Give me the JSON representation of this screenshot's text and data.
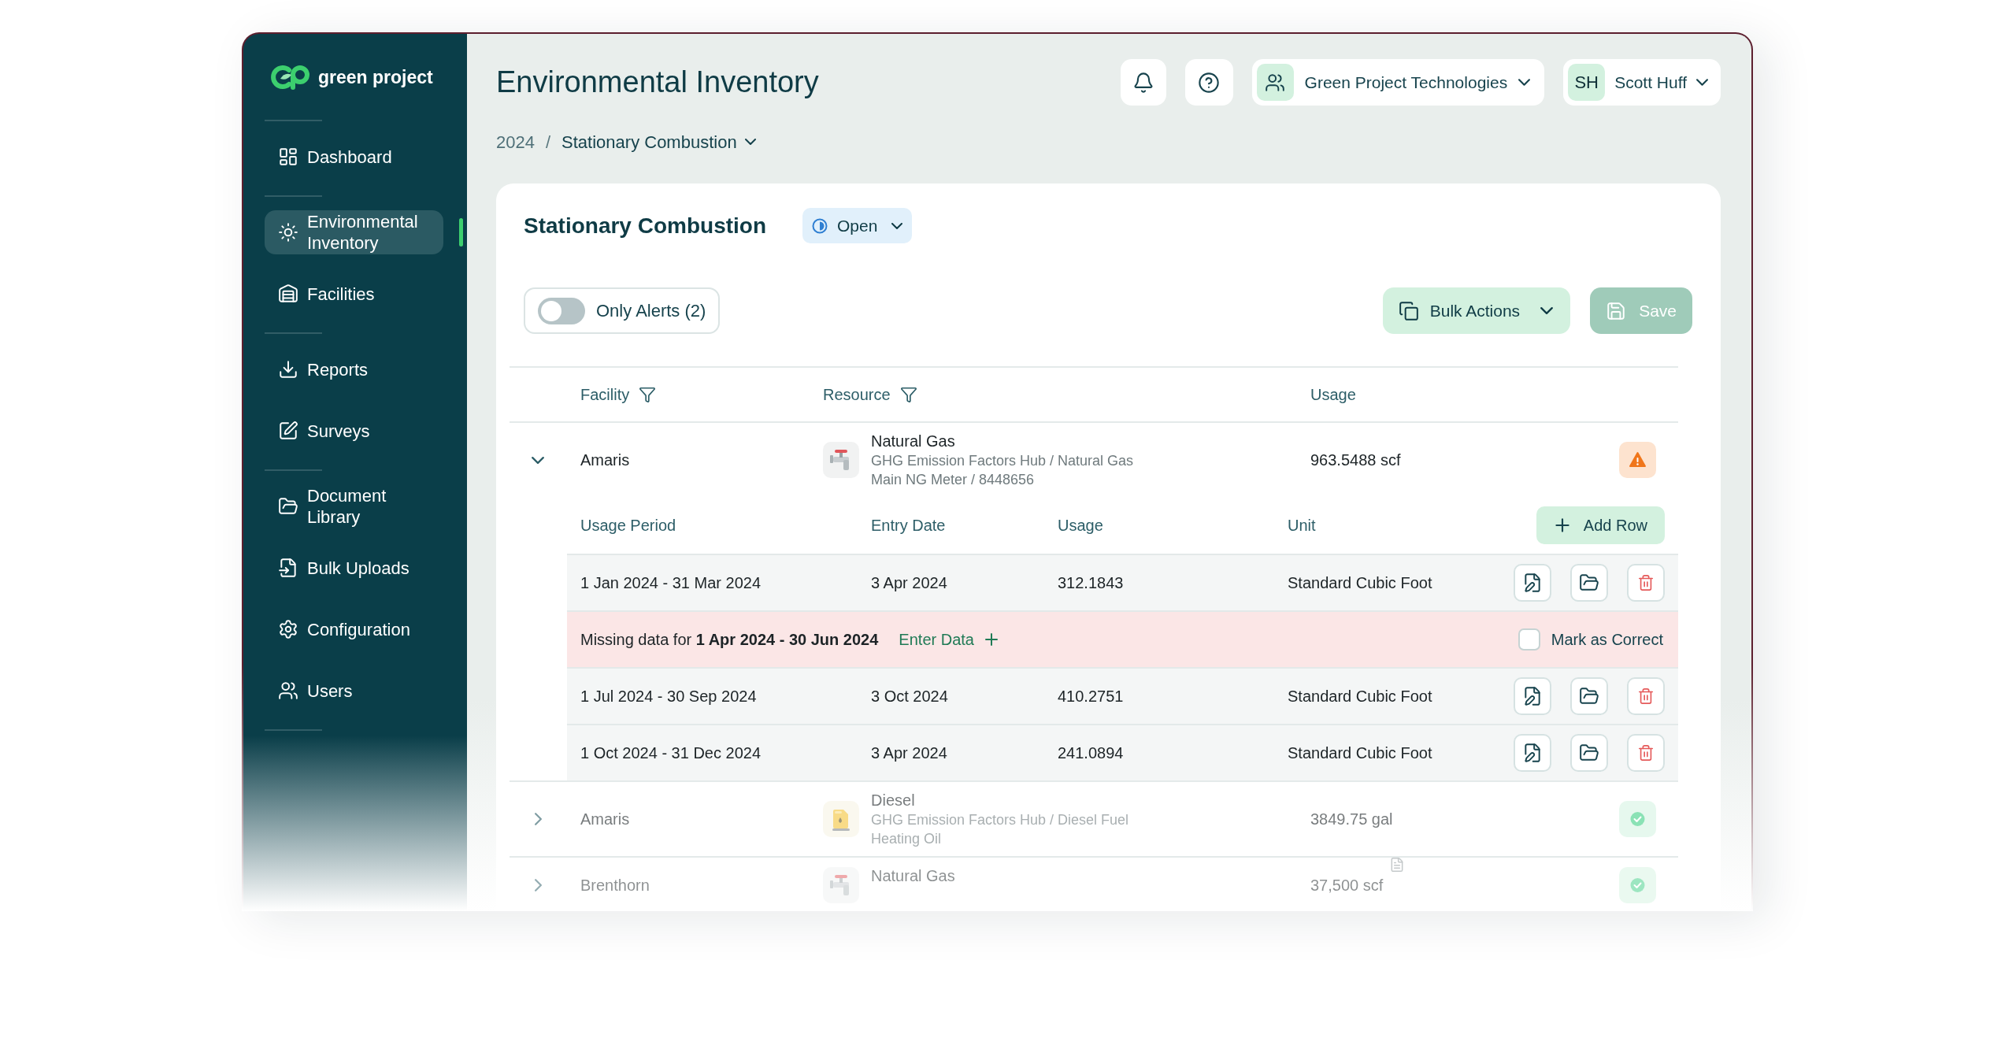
{
  "sidebar": {
    "logo": {
      "text": "green project"
    },
    "sections": [
      {
        "items": [
          {
            "label": "Dashboard",
            "selected": false
          }
        ]
      },
      {
        "items": [
          {
            "label": "Environmental Inventory",
            "selected": true
          },
          {
            "label": "Facilities",
            "selected": false
          }
        ]
      },
      {
        "items": [
          {
            "label": "Reports",
            "selected": false
          },
          {
            "label": "Surveys",
            "selected": false
          }
        ]
      },
      {
        "items": [
          {
            "label": "Document Library",
            "selected": false
          },
          {
            "label": "Bulk Uploads",
            "selected": false
          },
          {
            "label": "Configuration",
            "selected": false
          },
          {
            "label": "Users",
            "selected": false
          }
        ]
      }
    ]
  },
  "header": {
    "title": "Environmental Inventory",
    "organization": "Green Project Technologies",
    "user": {
      "initials": "SH",
      "name": "Scott Huff"
    }
  },
  "breadcrumb": {
    "items": [
      "2024",
      "Stationary Combustion"
    ],
    "separator": "/"
  },
  "panel": {
    "title": "Stationary Combustion",
    "status": "Open",
    "alerts_toggle": {
      "label": "Only Alerts (2)",
      "on": false
    },
    "bulk_actions": "Bulk Actions",
    "save": {
      "label": "Save",
      "disabled": true
    }
  },
  "table": {
    "columns": [
      {
        "label": "Facility",
        "filter": true
      },
      {
        "label": "Resource",
        "filter": true
      },
      {
        "label": "Usage",
        "filter": false
      }
    ],
    "rows": [
      {
        "facility": "Amaris",
        "expanded": true,
        "resource": {
          "kind": "gas",
          "name": "Natural Gas",
          "source": "GHG Emission Factors Hub / Natural Gas",
          "meter": "Main NG Meter / 8448656"
        },
        "usage": "963.5488 scf",
        "has_note": false,
        "alert": true,
        "details": {
          "columns": [
            "Usage Period",
            "Entry Date",
            "Usage",
            "Unit"
          ],
          "add_button": "Add Row",
          "entries": [
            {
              "kind": "entry",
              "period": "1 Jan 2024 - 31 Mar 2024",
              "entry_date": "3 Apr 2024",
              "usage": "312.1843",
              "unit": "Standard Cubic Foot"
            },
            {
              "kind": "missing",
              "message": "Missing data for **1 Apr 2024 - 30 Jun 2024**",
              "link": "Enter Data",
              "checkbox": {
                "label": "Mark as Correct",
                "checked": false
              }
            },
            {
              "kind": "entry",
              "period": "1 Jul 2024 - 30 Sep 2024",
              "entry_date": "3 Oct 2024",
              "usage": "410.2751",
              "unit": "Standard Cubic Foot"
            },
            {
              "kind": "entry",
              "period": "1 Oct 2024 - 31 Dec 2024",
              "entry_date": "3 Apr 2024",
              "usage": "241.0894",
              "unit": "Standard Cubic Foot"
            }
          ]
        }
      },
      {
        "facility": "Amaris",
        "expanded": false,
        "resource": {
          "kind": "fuel",
          "name": "Diesel",
          "source": "GHG Emission Factors Hub / Diesel Fuel",
          "meter": "Heating Oil"
        },
        "usage": "3849.75 gal",
        "has_note": false,
        "alert": false
      },
      {
        "facility": "Brenthorn",
        "expanded": false,
        "resource": {
          "kind": "gas",
          "name": "Natural Gas"
        },
        "usage": "37,500 scf",
        "has_note": true,
        "alert": false
      }
    ]
  }
}
